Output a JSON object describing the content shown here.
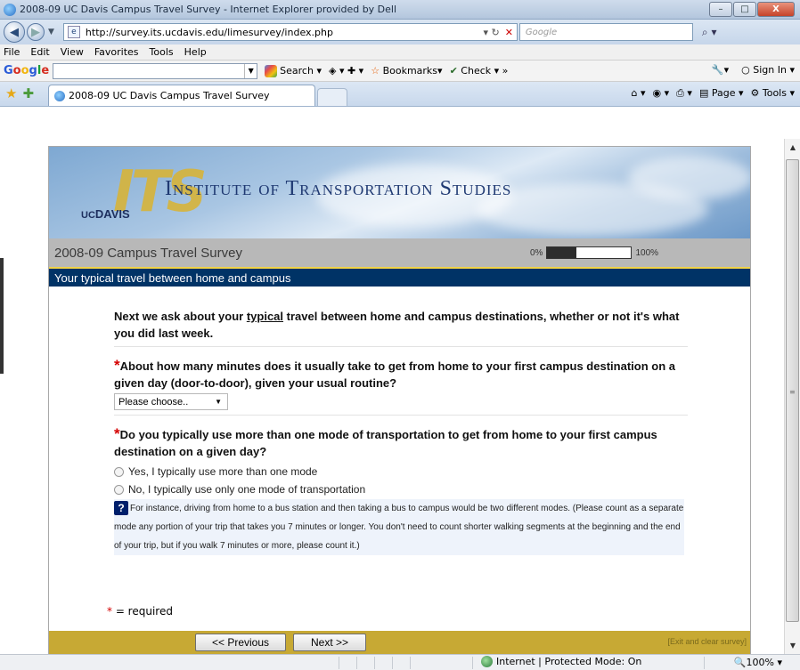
{
  "window": {
    "title": "2008-09 UC Davis Campus Travel Survey - Internet Explorer provided by Dell",
    "min": "–",
    "max": "□",
    "close": "X"
  },
  "address": {
    "url": "http://survey.its.ucdavis.edu/limesurvey/index.php",
    "search_placeholder": "Google"
  },
  "menu": [
    "File",
    "Edit",
    "View",
    "Favorites",
    "Tools",
    "Help"
  ],
  "google_toolbar": {
    "search_label": "Search",
    "bookmarks_label": "Bookmarks",
    "check_label": "Check",
    "more": "»",
    "sign_in": "Sign In"
  },
  "tab": {
    "label": "2008-09 UC Davis Campus Travel Survey"
  },
  "command_bar": {
    "page_label": "Page",
    "tools_label": "Tools"
  },
  "survey": {
    "org_name": "Institute of Transportation Studies",
    "logo_text": "ITS",
    "uc_label": "UC",
    "davis_label": "DAVIS",
    "title": "2008-09 Campus Travel Survey",
    "progress": {
      "min_label": "0%",
      "max_label": "100%",
      "fraction": 0.35
    },
    "section": "Your typical travel between home and campus",
    "intro_pre": "Next we ask about your ",
    "intro_emph": "typical",
    "intro_post": " travel between home and campus destinations, whether or not it's what you did last week.",
    "q1": {
      "marker": "*",
      "text": "About how many minutes does it usually take to get from home to your first campus destination on a given day (door-to-door), given your usual routine?",
      "select_value": "Please choose.."
    },
    "q2": {
      "marker": "*",
      "text": "Do you typically use more than one mode of transportation to get from home to your first campus destination on a given day?",
      "options": [
        "Yes, I typically use more than one mode",
        "No, I typically use only one mode of transportation"
      ]
    },
    "help_icon": "?",
    "help_text": "For instance, driving from home to a bus station and then taking a bus to campus would be two different modes. (Please count as a separate mode any portion of your trip that takes you 7 minutes or longer. You don't need to count shorter walking segments at the beginning and the end of your trip, but if you walk 7 minutes or more, please count it.)",
    "required_marker": "*",
    "required_note": " = required",
    "prev_button": "<< Previous",
    "next_button": "Next >>",
    "exit_link": "[Exit and clear survey]"
  },
  "status": {
    "zone": "Internet | Protected Mode: On",
    "zoom": "100%"
  }
}
